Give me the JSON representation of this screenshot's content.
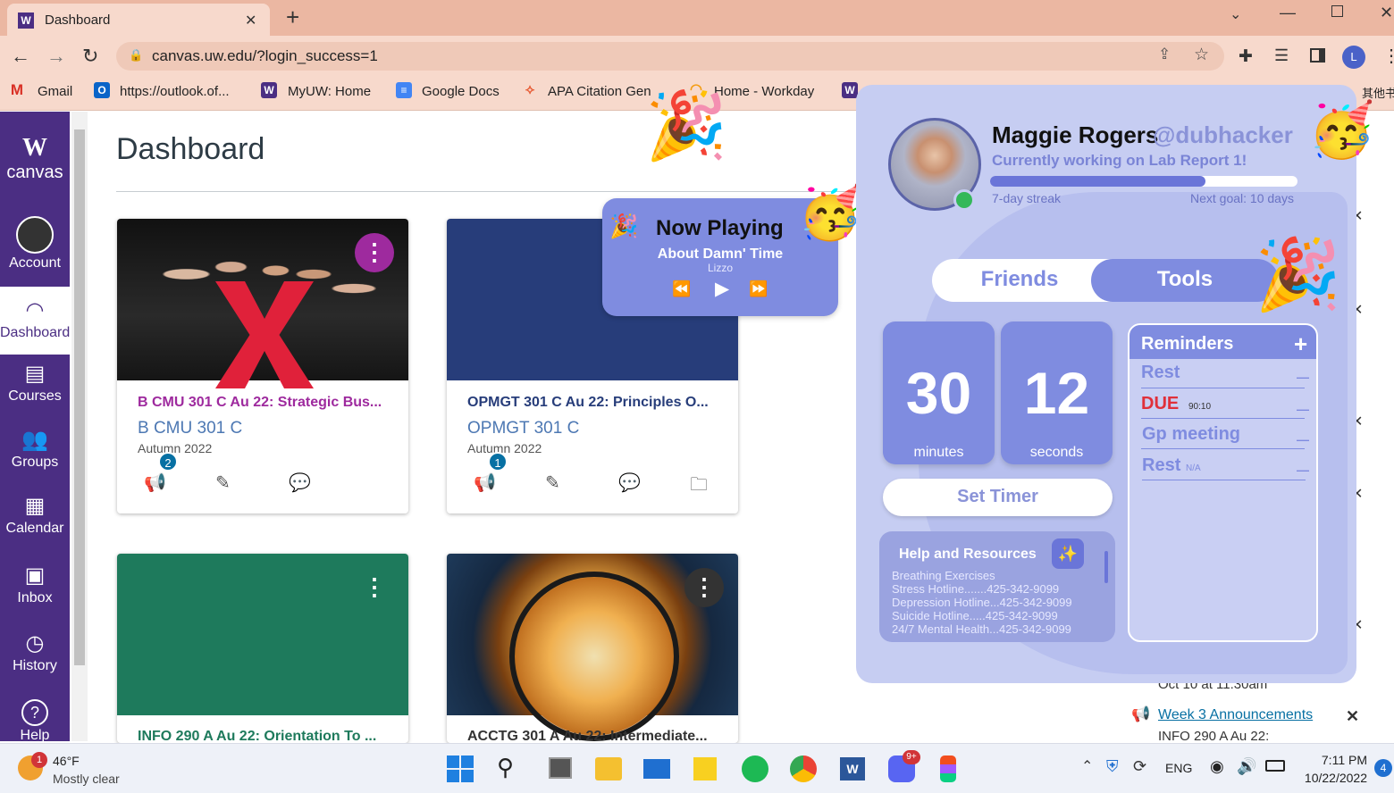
{
  "browser": {
    "tab_title": "Dashboard",
    "tab_close": "✕",
    "new_tab": "+",
    "url": "canvas.uw.edu/?login_success=1",
    "profile_initial": "L",
    "bookmarks": [
      "Gmail",
      "https://outlook.of...",
      "MyUW: Home",
      "Google Docs",
      "APA Citation Gen",
      "Home - Workday",
      "其他书签"
    ]
  },
  "nav": {
    "logo_w": "W",
    "logo_text": "canvas",
    "items": [
      "Account",
      "Dashboard",
      "Courses",
      "Groups",
      "Calendar",
      "Inbox",
      "History",
      "Help"
    ]
  },
  "page": {
    "title": "Dashboard"
  },
  "cards": [
    {
      "title": "B CMU 301 C Au 22: Strategic Bus...",
      "code": "B CMU 301 C",
      "term": "Autumn 2022",
      "badge": "2",
      "color": "#9e2a9e"
    },
    {
      "title": "OPMGT 301 C Au 22: Principles O...",
      "code": "OPMGT 301 C",
      "term": "Autumn 2022",
      "badge": "1",
      "color": "#273d7a"
    },
    {
      "title": "INFO 290 A Au 22: Orientation To ...",
      "color": "#1e7a5c"
    },
    {
      "title": "ACCTG 301 A Au 22: Intermediate...",
      "color": "#333333"
    }
  ],
  "sidebar_right": {
    "date_text": "Oct 10 at 11:30am",
    "announcement_link": "Week 3 Announcements",
    "announcement_course": "INFO 290 A Au 22:"
  },
  "now_playing": {
    "heading": "Now Playing",
    "song": "About Damn' Time",
    "artist": "Lizzo",
    "prev": "⏪",
    "play": "▶",
    "next": "⏩"
  },
  "profile": {
    "name": "Maggie Rogers",
    "handle": "@dubhacker",
    "status": "Currently working on Lab Report 1!",
    "streak_label": "7-day streak",
    "goal_label": "Next goal: 10 days",
    "streak_progress": 0.7
  },
  "tabs": {
    "friends": "Friends",
    "tools": "Tools"
  },
  "timer": {
    "minutes_value": "30",
    "minutes_label": "minutes",
    "seconds_value": "12",
    "seconds_label": "seconds",
    "button": "Set Timer"
  },
  "reminders": {
    "title": "Reminders",
    "add": "+",
    "items": [
      {
        "text": "Rest",
        "note": ""
      },
      {
        "text": "DUE",
        "note": "90:10"
      },
      {
        "text": "Gp meeting",
        "note": ""
      },
      {
        "text": "Rest",
        "note": "N/A"
      }
    ],
    "remove": "—"
  },
  "resources": {
    "title": "Help and Resources",
    "lines": [
      "Breathing Exercises",
      "Stress Hotline.......425-342-9099",
      "Depression Hotline...425-342-9099",
      "Suicide Hotline.....425-342-9099",
      "24/7 Mental Health...425-342-9099"
    ]
  },
  "taskbar": {
    "weather_temp": "46°F",
    "weather_desc": "Mostly clear",
    "weather_badge": "1",
    "lang": "ENG",
    "time": "7:11 PM",
    "date": "10/22/2022",
    "notif": "4",
    "discord_badge": "9+"
  },
  "colors": {
    "nav_bg": "#4b2e83",
    "widget_bg": "#c6cdf2",
    "accent": "#7f8ce0",
    "due_red": "#e0303a"
  }
}
